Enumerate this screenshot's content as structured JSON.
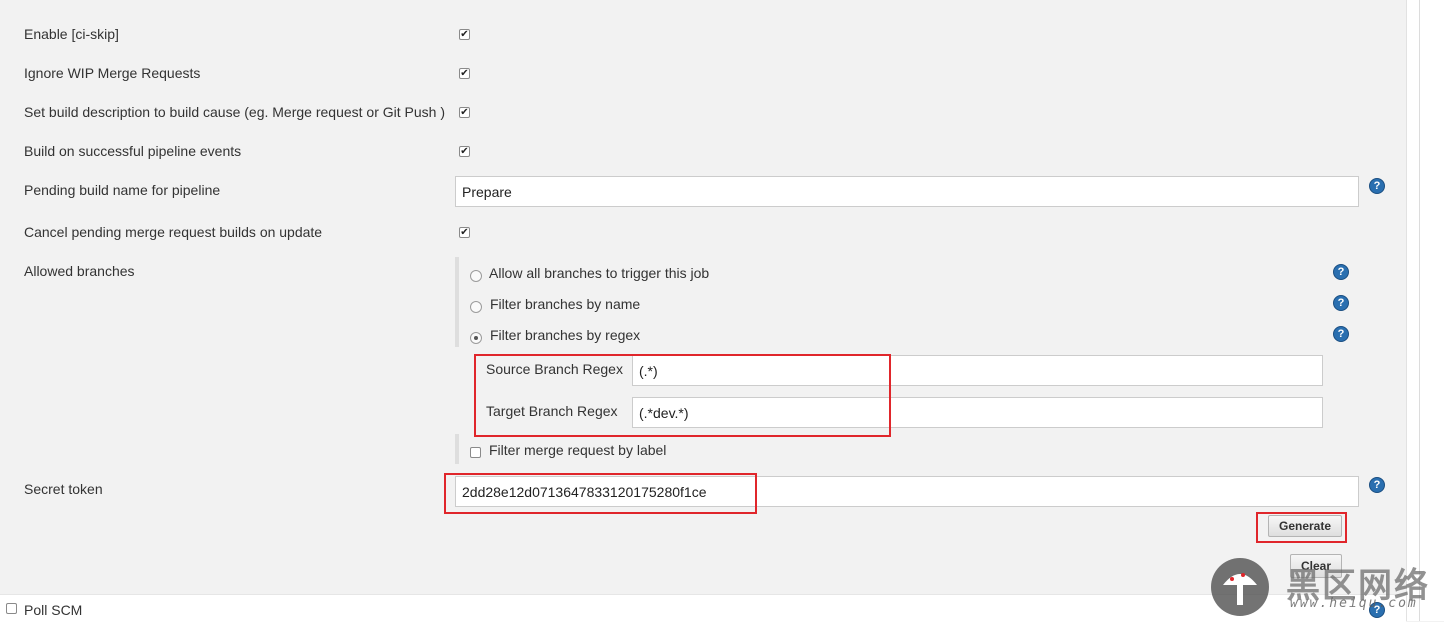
{
  "options": [
    {
      "label": "Enable [ci-skip]",
      "checked": true
    },
    {
      "label": "Ignore WIP Merge Requests",
      "checked": true
    },
    {
      "label": "Set build description to build cause (eg. Merge request or Git Push )",
      "checked": true
    },
    {
      "label": "Build on successful pipeline events",
      "checked": true
    }
  ],
  "pending_build": {
    "label": "Pending build name for pipeline",
    "value": "Prepare"
  },
  "cancel_pending": {
    "label": "Cancel pending merge request builds on update",
    "checked": true
  },
  "allowed_branches": {
    "label": "Allowed branches",
    "radios": [
      {
        "label": "Allow all branches to trigger this job",
        "selected": false
      },
      {
        "label": "Filter branches by name",
        "selected": false
      },
      {
        "label": "Filter branches by regex",
        "selected": true
      }
    ],
    "source_regex": {
      "label": "Source Branch Regex",
      "value": "(.*)"
    },
    "target_regex": {
      "label": "Target Branch Regex",
      "value": "(.*dev.*)"
    },
    "filter_label": {
      "label": "Filter merge request by label",
      "checked": false
    }
  },
  "secret_token": {
    "label": "Secret token",
    "value": "2dd28e12d0713647833120175280f1ce"
  },
  "buttons": {
    "generate": "Generate",
    "clear": "Clear"
  },
  "poll_scm": {
    "label": "Poll SCM",
    "checked": false
  },
  "help_glyph": "?",
  "check_glyph": "✔",
  "watermark": {
    "text": "黑区网络",
    "url": "www.heiqu.com"
  },
  "colors": {
    "highlight": "#e0262b",
    "help": "#2a6fb0",
    "background": "#f2f2f2"
  }
}
